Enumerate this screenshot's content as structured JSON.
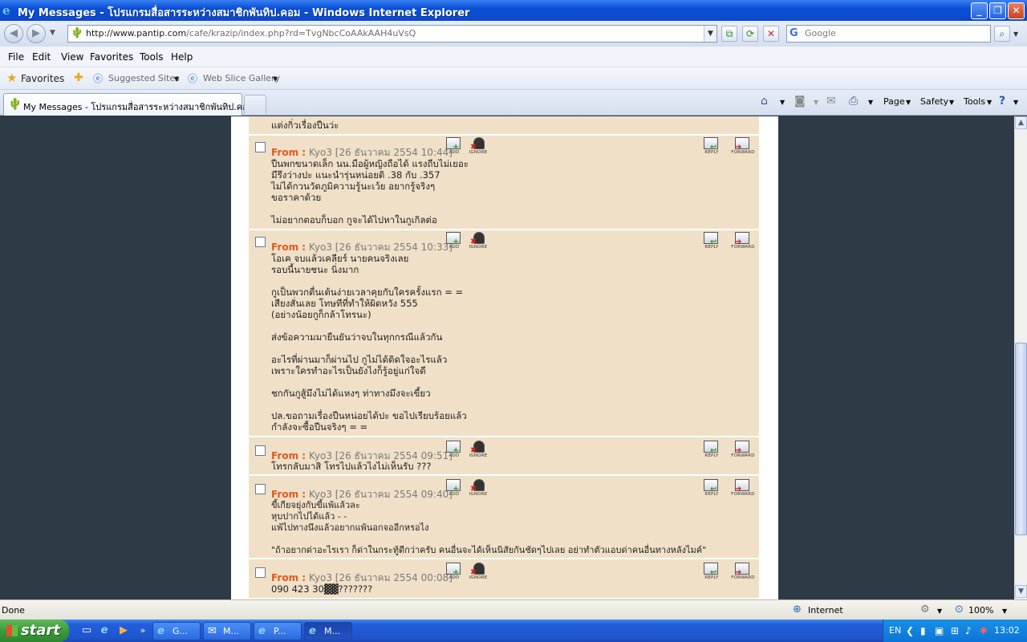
{
  "window": {
    "title": "My Messages - โปรแกรมสื่อสารระหว่างสมาชิกพันทิป.คอม - Windows Internet Explorer",
    "controls": [
      "_",
      "❐",
      "✕"
    ]
  },
  "address": {
    "url_host": "http://www.pantip.com",
    "url_path": "/cafe/krazip/index.php?rd=TvgNbcCoAAkAAH4uVsQ",
    "search_placeholder": "Google"
  },
  "menu": [
    "File",
    "Edit",
    "View",
    "Favorites",
    "Tools",
    "Help"
  ],
  "favorites_bar": {
    "favorites_label": "Favorites",
    "suggested_sites": "Suggested Sites",
    "web_slice_gallery": "Web Slice Gallery"
  },
  "tab": {
    "title": "My Messages - โปรแกรมสื่อสารระหว่างสมาชิกพันทิป.คอม"
  },
  "command_bar": {
    "page": "Page",
    "safety": "Safety",
    "tools": "Tools"
  },
  "messages": {
    "partial_top": "แต่งกิ่วเรื่องปืนว่ะ",
    "from_label": "From :",
    "icons": {
      "add": "ADD",
      "ignore": "IGNORE",
      "reply": "REPLY",
      "forward": "FORWARD"
    },
    "items": [
      {
        "from_text": "Kyo3 [26 ธันวาคม 2554 10:44]",
        "body": "ปืนพกขนาดเล็ก นน.มือผู้หญิงถือได้ แรงถีบไม่เยอะ\nมีรึงว่างปะ แนะนำรุ่นหน่อยดิ .38 กับ .357\nไม่ได้กวนวัดภูมิความรู้นะเว้ย อยากรู้จริงๆ\nขอราคาด้วย\n\nไม่อยากตอบก็บอก กูจะได้ไปหาในกูเกิลต่อ"
      },
      {
        "from_text": "Kyo3 [26 ธันวาคม 2554 10:33]",
        "body": "โอเค จบแล้วเคลียร์ นายคนจริงเลย\nรอบนี้นายชนะ นิ่งมาก\n\nกูเป็นพวกตื่นเต้นง่ายเวลาคุยกับใครครั้งแรก = =\nเสียงสั่นเลย โทษทีที่ทำให้ผิดหวัง 555\n(อย่างน้อยกูก็กล้าโทรนะ)\n\nส่งข้อความมายืนยันว่าจบในทุกกรณีแล้วกัน\n\nอะไรที่ผ่านมาก็ผ่านไป กูไม่ได้ติดใจอะไรแล้ว\nเพราะใครทำอะไรเป็นยังไงก็รู้อยู่แก่ใจดี\n\nชกกันกูสู้มึงไม่ได้แหงๆ ท่าทางมึงจะเขี้ยว\n\nปล.ขอถามเรื่องปืนหน่อยได้ปะ ขอไปเรียบร้อยแล้ว\nกำลังจะซื้อปืนจริงๆ = ="
      },
      {
        "from_text": "Kyo3 [26 ธันวาคม 2554 09:51]",
        "body": "โทรกลับมาสิ โทรไปแล้วไงไม่เห็นรับ ???"
      },
      {
        "from_text": "Kyo3 [26 ธันวาคม 2554 09:40]",
        "body": "ขี้เกียจยุ่งกับขี้แพ้แล้วละ\nหุบปากไปได้แล้ว - -\nแพ้ไปทางนึงแล้วอยากแพ้นอกจออีกหรอไง\n\n\"ถ้าอยากด่าอะไรเรา ก็ด่าในกระทู้ดีกว่าครับ คนอื่นจะได้เห็นนิสัยกันชัดๆไปเลย อย่าทำตัวแอบด่าคนอื่นทางหลังไมค์\""
      },
      {
        "from_text": "Kyo3 [26 ธันวาคม 2554 00:08]",
        "body": "090 423 30▓▓???????"
      }
    ]
  },
  "status_bar": {
    "status": "Done",
    "zone": "Internet",
    "zoom": "100%"
  },
  "taskbar": {
    "start_label": "start",
    "buttons": [
      "G...",
      "M...",
      "P...",
      "M..."
    ],
    "language": "EN",
    "clock": "13:02"
  }
}
